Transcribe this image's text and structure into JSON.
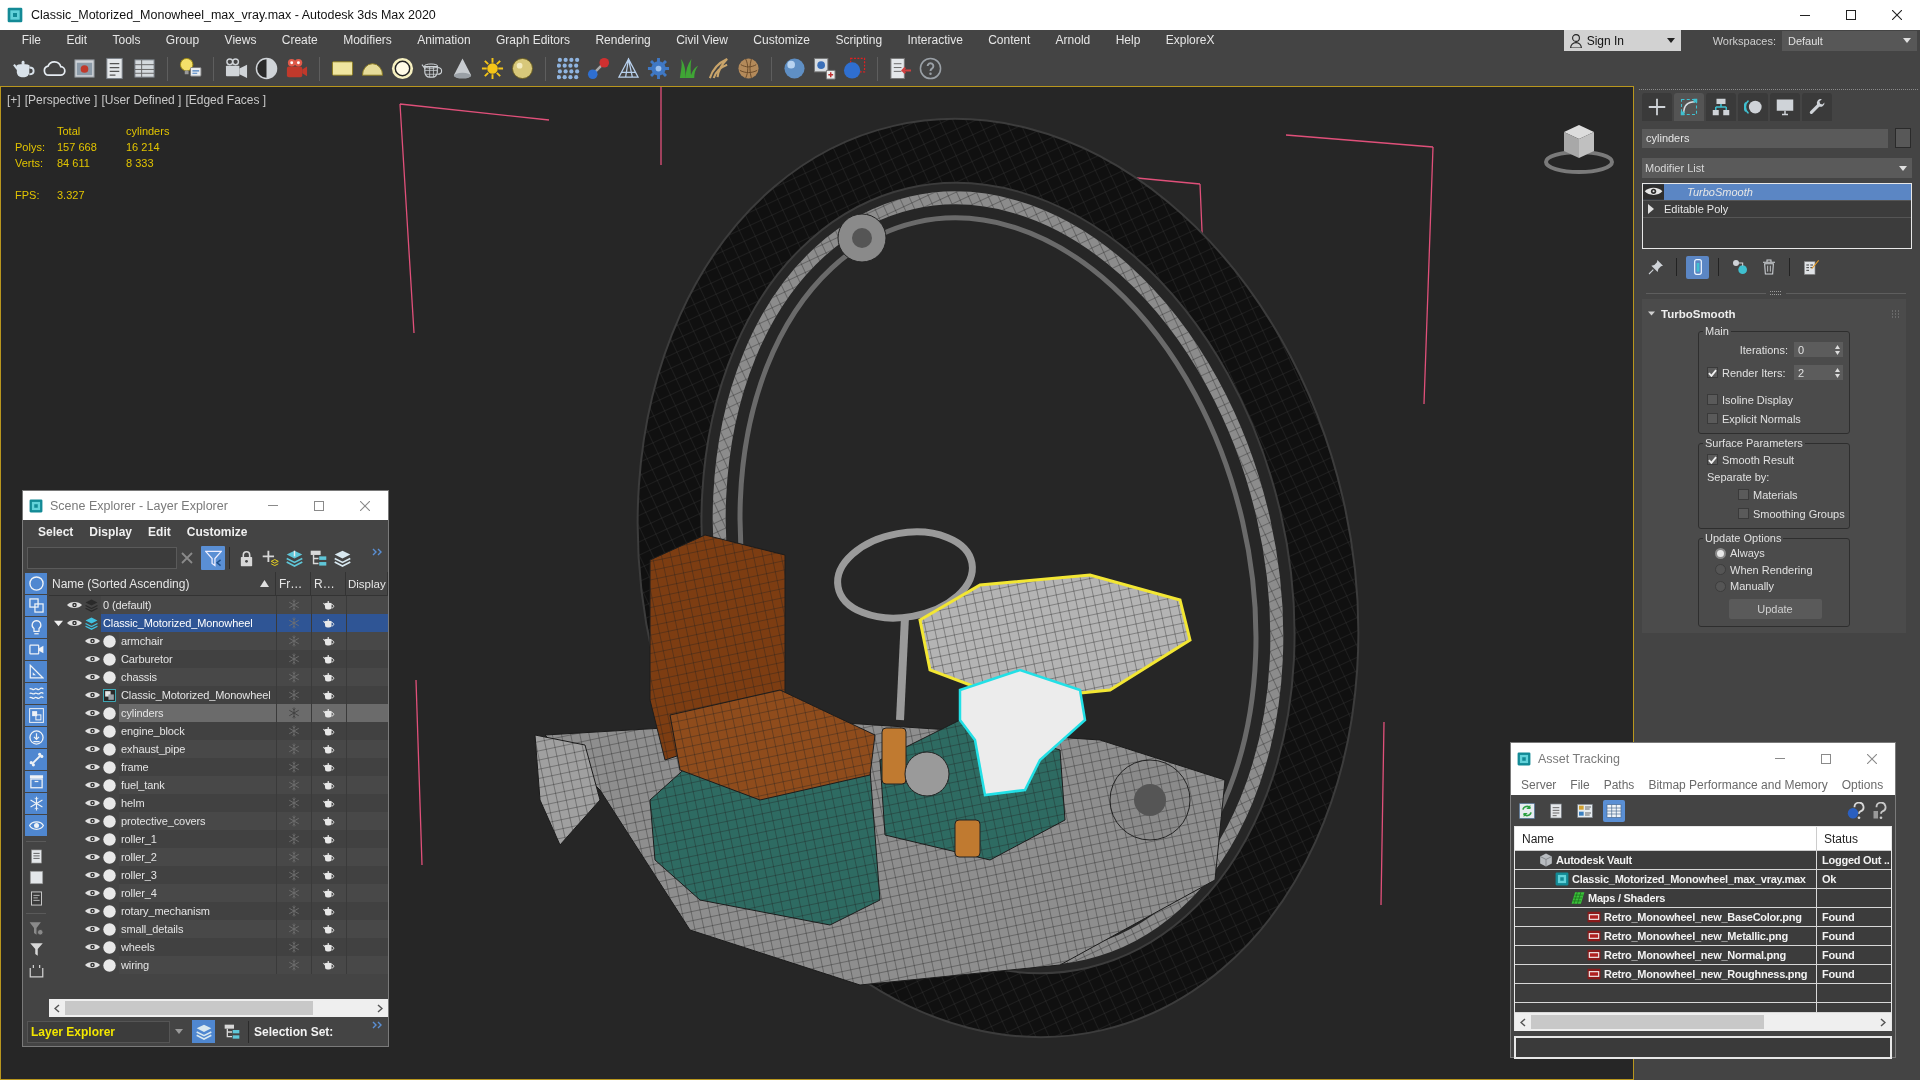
{
  "window": {
    "title": "Classic_Motorized_Monowheel_max_vray.max - Autodesk 3ds Max 2020"
  },
  "menu": [
    "File",
    "Edit",
    "Tools",
    "Group",
    "Views",
    "Create",
    "Modifiers",
    "Animation",
    "Graph Editors",
    "Rendering",
    "Civil View",
    "Customize",
    "Scripting",
    "Interactive",
    "Content",
    "Arnold",
    "Help",
    "ExploreX"
  ],
  "account": {
    "label": "Sign In"
  },
  "workspaces": {
    "label": "Workspaces:",
    "value": "Default"
  },
  "viewport": {
    "labels": [
      "[+]",
      "[Perspective ]",
      "[User Defined ]",
      "[Edged Faces ]"
    ],
    "stats": {
      "columns": [
        "Total",
        "cylinders"
      ],
      "rows": [
        {
          "label": "Polys:",
          "values": [
            "157 668",
            "16 214"
          ]
        },
        {
          "label": "Verts:",
          "values": [
            "84 611",
            "8 333"
          ]
        }
      ],
      "fps_label": "FPS:",
      "fps": "3.327"
    }
  },
  "scene_explorer": {
    "title": "Scene Explorer - Layer Explorer",
    "menu": [
      "Select",
      "Display",
      "Edit",
      "Customize"
    ],
    "toolbar": [
      {
        "kind": "filter",
        "on": true
      },
      {
        "kind": "lock",
        "on": false
      },
      {
        "kind": "add_layer",
        "on": false
      },
      {
        "kind": "layers_add",
        "on": false
      },
      {
        "kind": "hierarchy",
        "on": false
      },
      {
        "kind": "layers",
        "on": false
      }
    ],
    "filters": [
      {
        "kind": "geometry",
        "on": true
      },
      {
        "kind": "shape",
        "on": true
      },
      {
        "kind": "light",
        "on": true
      },
      {
        "kind": "camera",
        "on": true
      },
      {
        "kind": "helper",
        "on": true
      },
      {
        "kind": "spacewarp",
        "on": true
      },
      {
        "kind": "group",
        "on": true
      },
      {
        "kind": "xref",
        "on": true
      },
      {
        "kind": "bone",
        "on": true
      },
      {
        "kind": "container",
        "on": true
      },
      {
        "kind": "frozen",
        "on": true
      },
      {
        "kind": "hidden",
        "on": true
      }
    ],
    "columns": [
      "Name (Sorted Ascending)",
      "Fr…",
      "R…",
      "Display"
    ],
    "layers": [
      {
        "name": "0 (default)",
        "active": false
      },
      {
        "name": "Classic_Motorized_Monowheel",
        "active": true,
        "expanded": true,
        "children": [
          {
            "name": "armchair",
            "kind": "object",
            "selected": false
          },
          {
            "name": "Carburetor",
            "kind": "object",
            "selected": false
          },
          {
            "name": "chassis",
            "kind": "object",
            "selected": false
          },
          {
            "name": "Classic_Motorized_Monowheel",
            "kind": "group",
            "selected": false
          },
          {
            "name": "cylinders",
            "kind": "object",
            "selected": true
          },
          {
            "name": "engine_block",
            "kind": "object",
            "selected": false
          },
          {
            "name": "exhaust_pipe",
            "kind": "object",
            "selected": false
          },
          {
            "name": "frame",
            "kind": "object",
            "selected": false
          },
          {
            "name": "fuel_tank",
            "kind": "object",
            "selected": false
          },
          {
            "name": "helm",
            "kind": "object",
            "selected": false
          },
          {
            "name": "protective_covers",
            "kind": "object",
            "selected": false
          },
          {
            "name": "roller_1",
            "kind": "object",
            "selected": false
          },
          {
            "name": "roller_2",
            "kind": "object",
            "selected": false
          },
          {
            "name": "roller_3",
            "kind": "object",
            "selected": false
          },
          {
            "name": "roller_4",
            "kind": "object",
            "selected": false
          },
          {
            "name": "rotary_mechanism",
            "kind": "object",
            "selected": false
          },
          {
            "name": "small_details",
            "kind": "object",
            "selected": false
          },
          {
            "name": "wheels",
            "kind": "object",
            "selected": false
          },
          {
            "name": "wiring",
            "kind": "object",
            "selected": false
          }
        ]
      }
    ],
    "footer": {
      "mode": "Layer Explorer",
      "buttons": [
        {
          "kind": "layers",
          "selected": true
        },
        {
          "kind": "hierarchy",
          "selected": false
        }
      ],
      "selection_label": "Selection Set:"
    }
  },
  "command_panel": {
    "tabs": [
      {
        "kind": "create",
        "selected": false
      },
      {
        "kind": "modify",
        "selected": true
      },
      {
        "kind": "hierarchy",
        "selected": false
      },
      {
        "kind": "motion",
        "selected": false
      },
      {
        "kind": "display",
        "selected": false
      },
      {
        "kind": "utilities",
        "selected": false
      }
    ],
    "object_name": "cylinders",
    "modifier_list": "Modifier List",
    "stack": [
      {
        "name": "TurboSmooth",
        "kind": "modifier",
        "selected": true
      },
      {
        "name": "Editable Poly",
        "kind": "base",
        "selected": false
      }
    ],
    "stack_tools": [
      {
        "kind": "pin",
        "on": false
      },
      {
        "kind": "end_result",
        "on": true
      },
      {
        "kind": "make_unique",
        "on": false
      },
      {
        "kind": "remove",
        "on": false
      },
      {
        "kind": "configure",
        "on": false
      }
    ],
    "rollout": {
      "title": "TurboSmooth",
      "expanded": true,
      "groups": [
        {
          "title": "Main",
          "items": [
            {
              "kind": "spinner",
              "label": "Iterations:",
              "value": "0"
            },
            {
              "kind": "check_spinner",
              "label": "Render Iters:",
              "value": "2",
              "checked": true
            },
            {
              "kind": "checkbox",
              "label": "Isoline Display",
              "checked": false
            },
            {
              "kind": "checkbox",
              "label": "Explicit Normals",
              "checked": false
            }
          ]
        },
        {
          "title": "Surface Parameters",
          "items": [
            {
              "kind": "checkbox",
              "label": "Smooth Result",
              "checked": true
            },
            {
              "kind": "text",
              "label": "Separate by:",
              "children": [
                {
                  "kind": "checkbox",
                  "label": "Materials",
                  "checked": false
                },
                {
                  "kind": "checkbox",
                  "label": "Smoothing Groups",
                  "checked": false
                }
              ]
            }
          ]
        },
        {
          "title": "Update Options",
          "items": [
            {
              "kind": "radio",
              "label": "Always",
              "selected": true
            },
            {
              "kind": "radio",
              "label": "When Rendering",
              "selected": false
            },
            {
              "kind": "radio",
              "label": "Manually",
              "selected": false
            }
          ],
          "button": "Update"
        }
      ]
    }
  },
  "asset_tracking": {
    "title": "Asset Tracking",
    "menu": [
      "Server",
      "File",
      "Paths",
      "Bitmap Performance and Memory",
      "Options"
    ],
    "toolbar": [
      {
        "kind": "refresh",
        "selected": false
      },
      {
        "kind": "list",
        "selected": false
      },
      {
        "kind": "thumbnails",
        "selected": false
      },
      {
        "kind": "table",
        "selected": true
      }
    ],
    "columns": [
      "Name",
      "Status"
    ],
    "rows": [
      {
        "name": "Autodesk Vault",
        "status": "Logged Out ..",
        "kind": "vault",
        "children": [
          {
            "name": "Classic_Motorized_Monowheel_max_vray.max",
            "status": "Ok",
            "kind": "scene",
            "children": [
              {
                "name": "Maps / Shaders",
                "kind": "maps",
                "children": [
                  {
                    "name": "Retro_Monowheel_new_BaseColor.png",
                    "status": "Found",
                    "kind": "png"
                  },
                  {
                    "name": "Retro_Monowheel_new_Metallic.png",
                    "status": "Found",
                    "kind": "png"
                  },
                  {
                    "name": "Retro_Monowheel_new_Normal.png",
                    "status": "Found",
                    "kind": "png"
                  },
                  {
                    "name": "Retro_Monowheel_new_Roughness.png",
                    "status": "Found",
                    "kind": "png"
                  }
                ]
              }
            ]
          }
        ]
      }
    ]
  }
}
